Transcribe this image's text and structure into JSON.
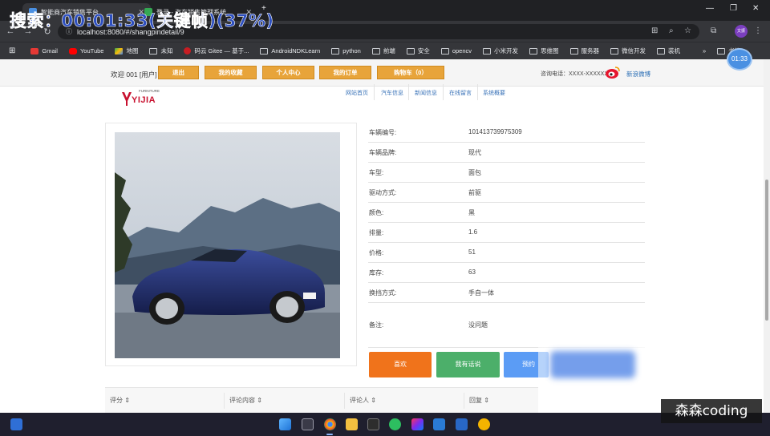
{
  "overlay": {
    "title": "搜索：00:01:33(关键帧)(37%)",
    "timer": "01:33",
    "watermark": "森森coding"
  },
  "browser": {
    "tabs": [
      {
        "label": "智能商汽车销售平台",
        "active": true
      },
      {
        "label": "登录 - 汽车销售管理系统",
        "active": false
      }
    ],
    "url": "localhost:8080/#/shangpindetail/9",
    "profile_label": "文振",
    "bookmarks": [
      "Gmail",
      "YouTube",
      "地图",
      "未知",
      "码云 Gitee — 基于...",
      "AndroidNDKLearn",
      "python",
      "前端",
      "安全",
      "opencv",
      "小米开发",
      "思维图",
      "服务器",
      "微信开发",
      "装机"
    ],
    "more_bookmarks": "书签"
  },
  "header": {
    "welcome": "欢迎 001 [用户]",
    "buttons": [
      "退出",
      "我的收藏",
      "个人中心",
      "我的订单",
      "购物车（0）"
    ],
    "hotline": "咨询电话：XXXX-XXXXXX",
    "weibo": "新浪微博"
  },
  "logo": {
    "word": "YIJIA",
    "sub": "FURNITURE"
  },
  "nav": [
    "网站首页",
    "汽车信息",
    "新闻信息",
    "在线留言",
    "系统概要"
  ],
  "details": [
    {
      "label": "车辆编号:",
      "value": "101413739975309"
    },
    {
      "label": "车辆品牌:",
      "value": "现代"
    },
    {
      "label": "车型:",
      "value": "面包"
    },
    {
      "label": "驱动方式:",
      "value": "前驱"
    },
    {
      "label": "颜色:",
      "value": "黑"
    },
    {
      "label": "排量:",
      "value": "1.6"
    },
    {
      "label": "价格:",
      "value": "51"
    },
    {
      "label": "库存:",
      "value": "63"
    },
    {
      "label": "换挡方式:",
      "value": "手自一体"
    },
    {
      "label": "备注:",
      "value": "没问题"
    }
  ],
  "actions": [
    {
      "label": "喜欢",
      "color": "#f0731b"
    },
    {
      "label": "我有话说",
      "color": "#4caf6a"
    },
    {
      "label": "预约",
      "color": "#5b9cf5"
    }
  ],
  "table": {
    "headers": [
      "评分",
      "评论内容",
      "评论人",
      "回复"
    ]
  }
}
